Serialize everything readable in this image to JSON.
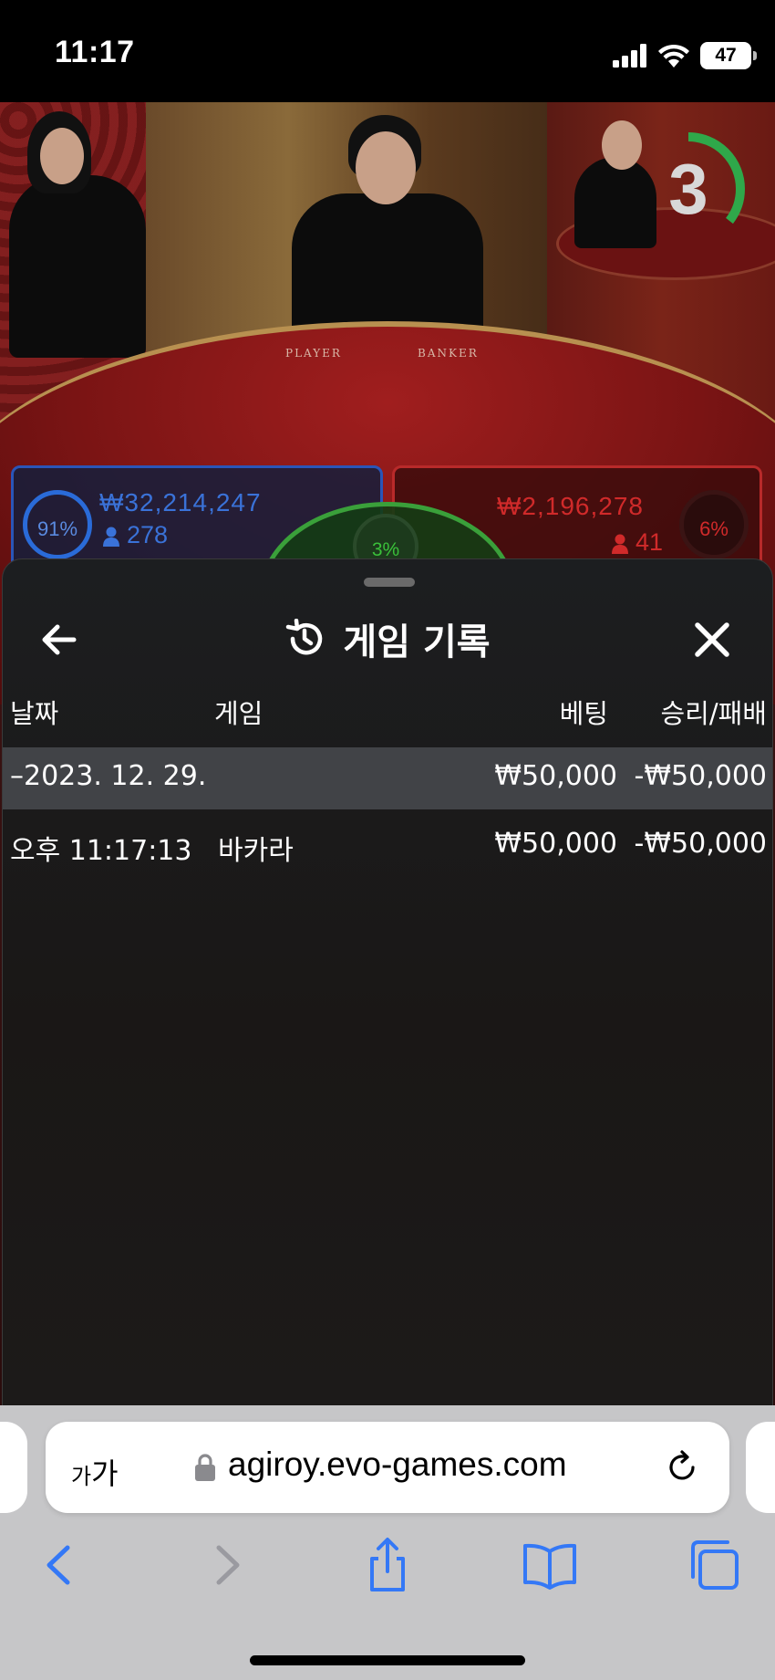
{
  "status_bar": {
    "time": "11:17",
    "battery": "47"
  },
  "game": {
    "timer": "3",
    "table_player_label": "PLAYER",
    "table_banker_label": "BANKER",
    "player": {
      "percent": "91%",
      "amount": "₩32,214,247",
      "bettors": "278",
      "color": "#2a6bd8"
    },
    "tie": {
      "percent": "3%",
      "color": "#3aa03a"
    },
    "banker": {
      "percent": "6%",
      "amount": "₩2,196,278",
      "bettors": "41",
      "color": "#d02a2a"
    }
  },
  "sheet": {
    "title": "게임 기록",
    "columns": {
      "date": "날짜",
      "game": "게임",
      "bet": "베팅",
      "win_loss": "승리/패배"
    },
    "date_row": {
      "date": "–2023. 12. 29.",
      "bet": "₩50,000",
      "win_loss": "-₩50,000"
    },
    "game_row": {
      "time": "오후 11:17:13",
      "game": "바카라",
      "bet": "₩50,000",
      "win_loss": "-₩50,000"
    }
  },
  "browser": {
    "text_size_label_small": "가",
    "text_size_label_large": "가",
    "url": "agiroy.evo-games.com",
    "accent": "#3478f6"
  }
}
